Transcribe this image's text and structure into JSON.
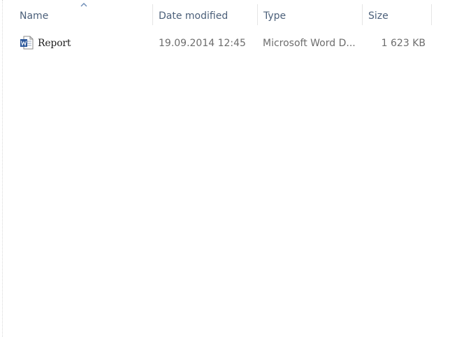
{
  "columns": {
    "name": "Name",
    "date_modified": "Date modified",
    "type": "Type",
    "size": "Size"
  },
  "sort": {
    "column": "name",
    "direction": "ascending"
  },
  "files": [
    {
      "name": "Report",
      "date_modified": "19.09.2014 12:45",
      "type": "Microsoft Word D...",
      "size": "1 623 KB",
      "icon": "word-document-icon"
    }
  ],
  "colors": {
    "header_text": "#4c607a",
    "row_text": "#6d6d6d",
    "word_blue": "#2b579a"
  }
}
